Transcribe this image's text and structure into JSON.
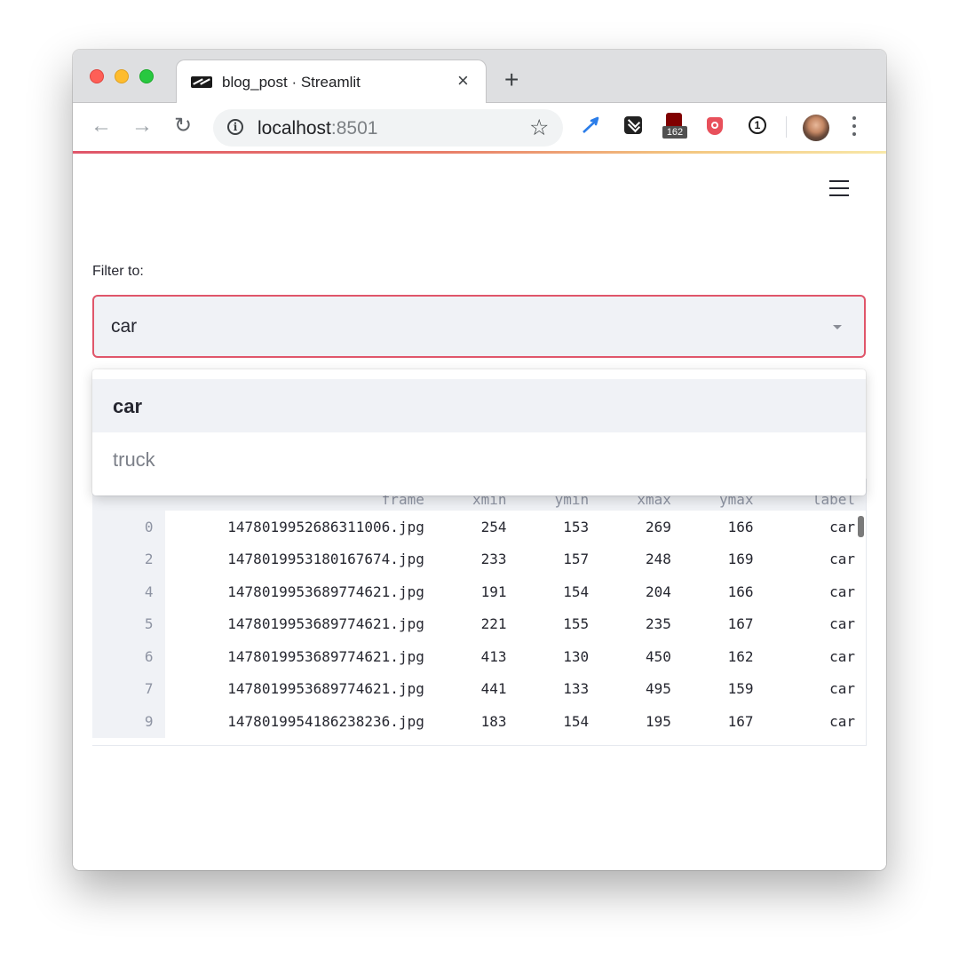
{
  "browser": {
    "tab_title": "blog_post · Streamlit",
    "tab_close_glyph": "×",
    "new_tab_glyph": "+",
    "url_host": "localhost",
    "url_port": ":8501",
    "ublock_count": "162",
    "onepassword_glyph": "①",
    "accent_gradient": [
      "#e0566a",
      "#e87c68",
      "#f3c680",
      "#f8e8a8"
    ]
  },
  "app": {
    "filter_label": "Filter to:",
    "selected_value": "car",
    "accent_color": "#e0566a",
    "dropdown_options": [
      "car",
      "truck"
    ]
  },
  "table": {
    "columns": [
      "frame",
      "xmin",
      "ymin",
      "xmax",
      "ymax",
      "label"
    ],
    "rows": [
      {
        "index": "0",
        "cells": [
          "1478019952686311006.jpg",
          "254",
          "153",
          "269",
          "166",
          "car"
        ]
      },
      {
        "index": "2",
        "cells": [
          "1478019953180167674.jpg",
          "233",
          "157",
          "248",
          "169",
          "car"
        ]
      },
      {
        "index": "4",
        "cells": [
          "1478019953689774621.jpg",
          "191",
          "154",
          "204",
          "166",
          "car"
        ]
      },
      {
        "index": "5",
        "cells": [
          "1478019953689774621.jpg",
          "221",
          "155",
          "235",
          "167",
          "car"
        ]
      },
      {
        "index": "6",
        "cells": [
          "1478019953689774621.jpg",
          "413",
          "130",
          "450",
          "162",
          "car"
        ]
      },
      {
        "index": "7",
        "cells": [
          "1478019953689774621.jpg",
          "441",
          "133",
          "495",
          "159",
          "car"
        ]
      },
      {
        "index": "9",
        "cells": [
          "1478019954186238236.jpg",
          "183",
          "154",
          "195",
          "167",
          "car"
        ]
      }
    ]
  }
}
